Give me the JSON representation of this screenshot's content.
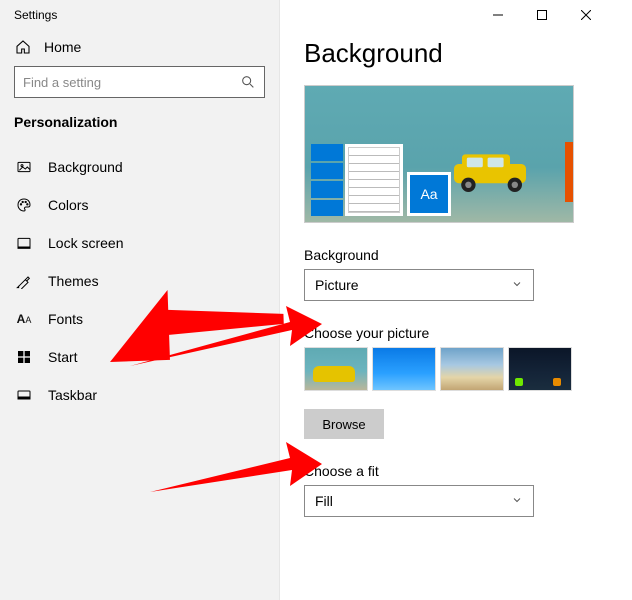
{
  "window_title": "Settings",
  "window_controls": {
    "min": "minimize",
    "max": "maximize",
    "close": "close"
  },
  "sidebar": {
    "home_label": "Home",
    "search_placeholder": "Find a setting",
    "section_label": "Personalization",
    "items": [
      {
        "label": "Background",
        "icon": "image-icon"
      },
      {
        "label": "Colors",
        "icon": "palette-icon"
      },
      {
        "label": "Lock screen",
        "icon": "lockscreen-icon"
      },
      {
        "label": "Themes",
        "icon": "themes-icon"
      },
      {
        "label": "Fonts",
        "icon": "fonts-icon"
      },
      {
        "label": "Start",
        "icon": "start-icon"
      },
      {
        "label": "Taskbar",
        "icon": "taskbar-icon"
      }
    ]
  },
  "page": {
    "title": "Background",
    "preview_accent_text": "Aa",
    "background_label": "Background",
    "background_value": "Picture",
    "choose_picture_label": "Choose your picture",
    "thumbs": [
      {
        "name": "wallpaper-yellow-car"
      },
      {
        "name": "wallpaper-blue"
      },
      {
        "name": "wallpaper-beach"
      },
      {
        "name": "wallpaper-night"
      }
    ],
    "browse_label": "Browse",
    "fit_label": "Choose a fit",
    "fit_value": "Fill"
  },
  "annotations": {
    "arrow1": "points to Background dropdown",
    "arrow2": "points to Browse button"
  }
}
